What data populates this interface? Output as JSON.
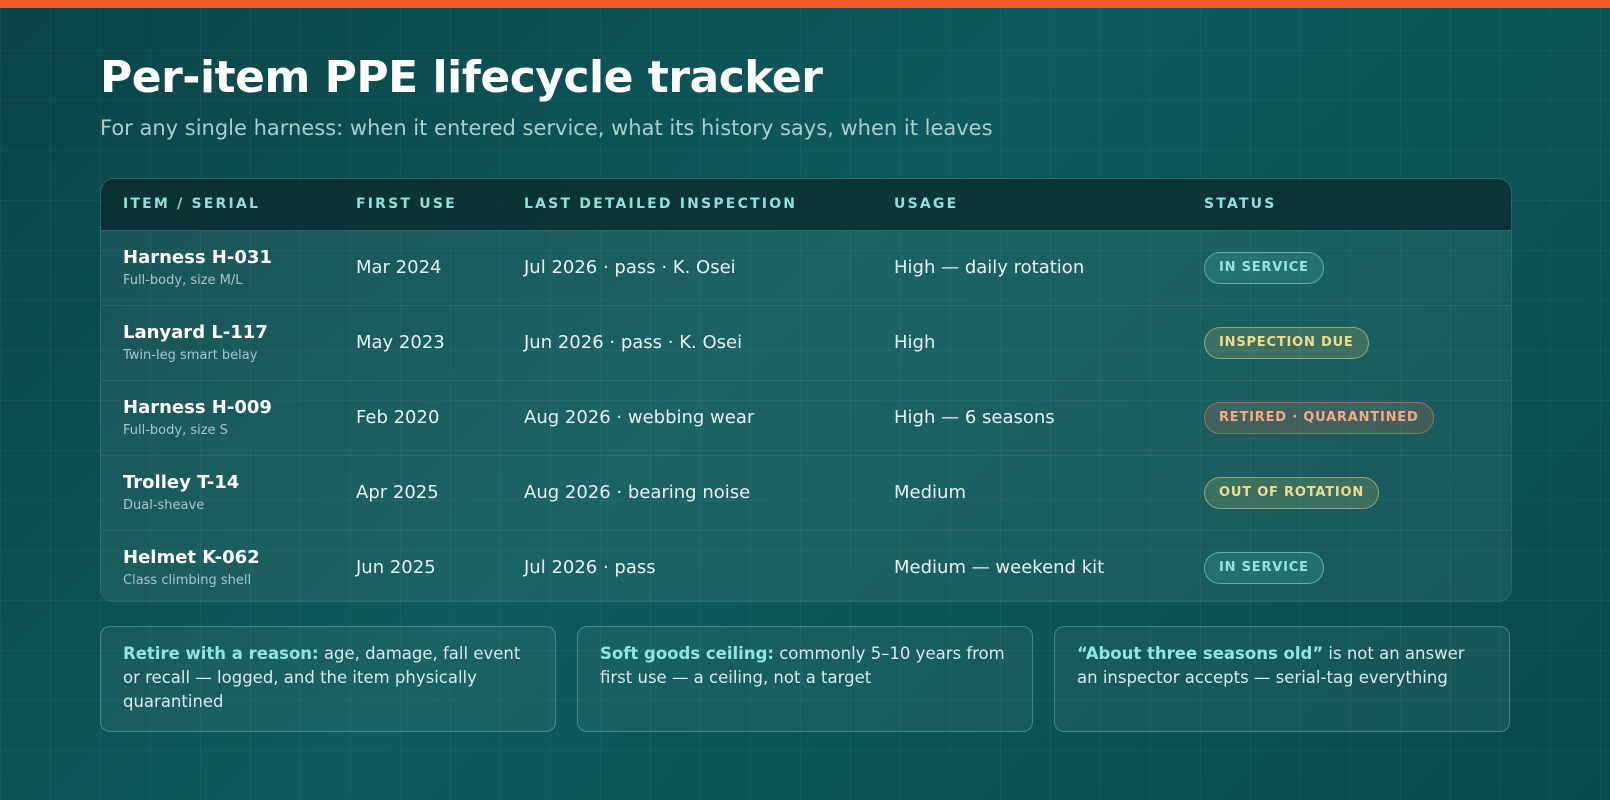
{
  "header": {
    "title": "Per-item PPE lifecycle tracker",
    "subtitle": "For any single harness: when it entered service, what its history says, when it leaves"
  },
  "table": {
    "columns": [
      "ITEM / SERIAL",
      "FIRST USE",
      "LAST DETAILED INSPECTION",
      "USAGE",
      "STATUS"
    ],
    "rows": [
      {
        "item": "Harness H-031",
        "desc": "Full-body, size M/L",
        "first_use": "Mar 2024",
        "inspection": "Jul 2026 · pass · K. Osei",
        "usage": "High — daily rotation",
        "status": "IN SERVICE"
      },
      {
        "item": "Lanyard L-117",
        "desc": "Twin-leg smart belay",
        "first_use": "May 2023",
        "inspection": "Jun 2026 · pass · K. Osei",
        "usage": "High",
        "status": "INSPECTION DUE"
      },
      {
        "item": "Harness H-009",
        "desc": "Full-body, size S",
        "first_use": "Feb 2020",
        "inspection": "Aug 2026 · webbing wear",
        "usage": "High — 6 seasons",
        "status": "RETIRED · QUARANTINED"
      },
      {
        "item": "Trolley T-14",
        "desc": "Dual-sheave",
        "first_use": "Apr 2025",
        "inspection": "Aug 2026 · bearing noise",
        "usage": "Medium",
        "status": "OUT OF ROTATION"
      },
      {
        "item": "Helmet K-062",
        "desc": "Class climbing shell",
        "first_use": "Jun 2025",
        "inspection": "Jul 2026 · pass",
        "usage": "Medium — weekend kit",
        "status": "IN SERVICE"
      }
    ]
  },
  "notes": [
    {
      "strong": "Retire with a reason:",
      "text": " age, damage, fall event or recall — logged, and the item physically quarantined"
    },
    {
      "strong": "Soft goods ceiling:",
      "text": " commonly 5–10 years from first use — a ceiling, not a target"
    },
    {
      "strong": "“About three seasons old”",
      "text": " is not an answer an inspector accepts — serial-tag everything"
    }
  ],
  "colors": {
    "accent_bar": "#f25c2a",
    "background": "#0c5456",
    "in_service": "#8fe6dd",
    "inspection_due": "#f0dc8c",
    "retired": "#f4a98c",
    "out_of_rotation": "#f0dc8c"
  }
}
